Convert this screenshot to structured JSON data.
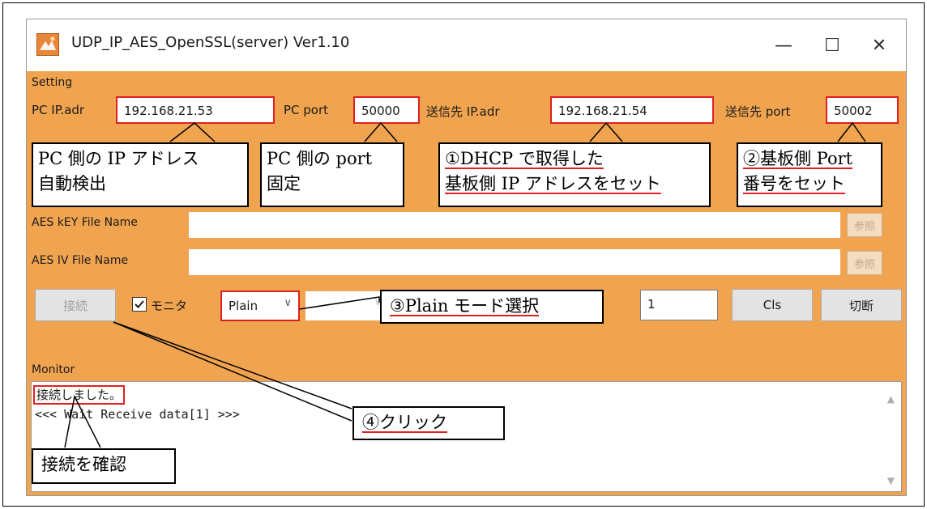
{
  "window": {
    "title": "UDP_IP_AES_OpenSSL(server) Ver1.10",
    "minimize": "—",
    "maximize": "☐",
    "close": "✕"
  },
  "setting": {
    "group_label": "Setting",
    "pc_ip_label": "PC IP.adr",
    "pc_ip_value": "192.168.21.53",
    "pc_port_label": "PC port",
    "pc_port_value": "50000",
    "dest_ip_label": "送信先 IP.adr",
    "dest_ip_value": "192.168.21.54",
    "dest_port_label": "送信先 port",
    "dest_port_value": "50002"
  },
  "callouts": {
    "pc_ip": [
      "PC 側の IP アドレス",
      "自動検出"
    ],
    "pc_port": [
      "PC 側の port",
      "固定"
    ],
    "dest_ip": [
      "①DHCP で取得した",
      "基板側 IP アドレスをセット"
    ],
    "dest_port": [
      "②基板側 Port",
      "番号をセット"
    ],
    "mode": "③Plain モード選択",
    "click": "④クリック",
    "confirm": "接続を確認"
  },
  "aes": {
    "key_label": "AES kEY File Name",
    "iv_label": "AES IV File Name",
    "browse_label": "参照"
  },
  "controls": {
    "connect_label": "接続",
    "monitor_checkbox_label": "モニタ",
    "mode_value": "Plain",
    "count_value": "1",
    "cls_label": "Cls",
    "disconnect_label": "切断"
  },
  "monitor": {
    "group_label": "Monitor",
    "lines": [
      "接続しました。",
      "<<< Wait Receive data[1] >>>"
    ]
  },
  "colors": {
    "panel": "#f0a450",
    "highlight": "#e02020"
  }
}
